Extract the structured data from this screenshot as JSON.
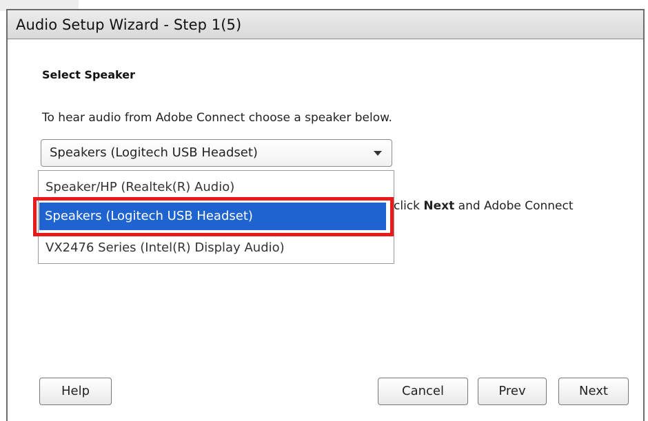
{
  "window": {
    "title": "Audio Setup Wizard - Step 1(5)"
  },
  "content": {
    "heading": "Select Speaker",
    "instruction": "To hear audio from Adobe Connect choose a speaker below.",
    "hidden_text_prefix": "click ",
    "hidden_text_bold": "Next",
    "hidden_text_suffix": " and Adobe Connect"
  },
  "speaker_select": {
    "selected": "Speakers (Logitech USB Headset)",
    "options": [
      "Speaker/HP (Realtek(R) Audio)",
      "Speakers (Logitech USB Headset)",
      "VX2476 Series (Intel(R) Display Audio)"
    ],
    "highlighted_index": 1
  },
  "buttons": {
    "help": "Help",
    "cancel": "Cancel",
    "prev": "Prev",
    "next": "Next"
  },
  "colors": {
    "highlight_option_bg": "#1e63d0",
    "annotation_border": "#ea1a1a"
  }
}
